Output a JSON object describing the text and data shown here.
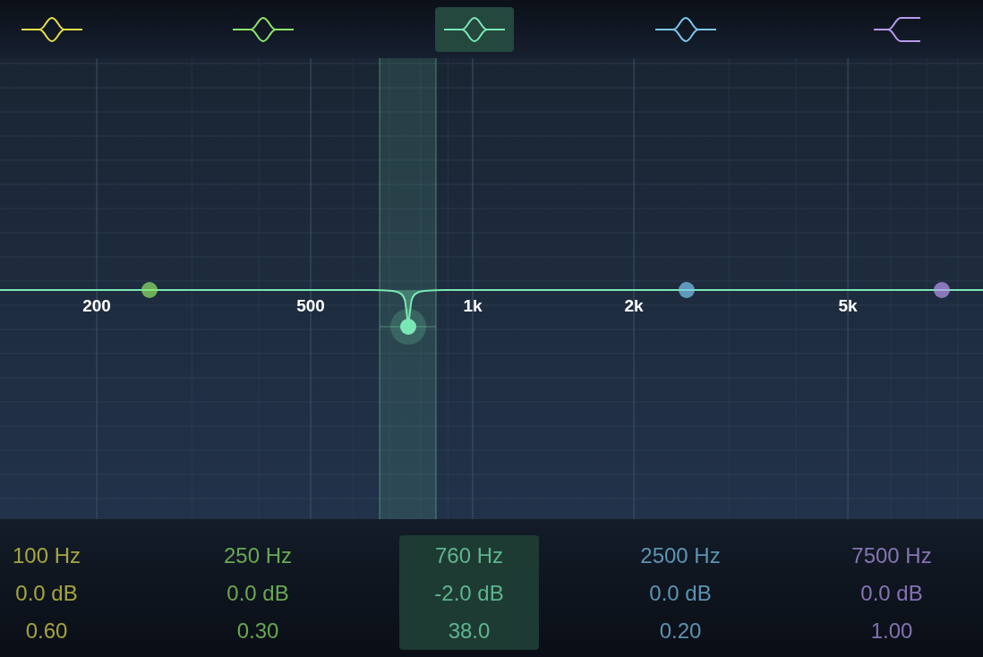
{
  "bands": [
    {
      "kind": "bell",
      "color": "#e6e04a",
      "selected": false,
      "frequency": "100 Hz",
      "gain": "0.0 dB",
      "q": "0.60"
    },
    {
      "kind": "bell",
      "color": "#8ee66a",
      "selected": false,
      "frequency": "250 Hz",
      "gain": "0.0 dB",
      "q": "0.30"
    },
    {
      "kind": "bell",
      "color": "#7ae8b5",
      "selected": true,
      "frequency": "760 Hz",
      "gain": "-2.0 dB",
      "q": "38.0"
    },
    {
      "kind": "bell",
      "color": "#7cc8f0",
      "selected": false,
      "frequency": "2500 Hz",
      "gain": "0.0 dB",
      "q": "0.20"
    },
    {
      "kind": "shelf",
      "color": "#b89af0",
      "selected": false,
      "frequency": "7500 Hz",
      "gain": "0.0 dB",
      "q": "1.00"
    }
  ],
  "freq_labels": [
    "200",
    "500",
    "1k",
    "2k",
    "5k"
  ]
}
